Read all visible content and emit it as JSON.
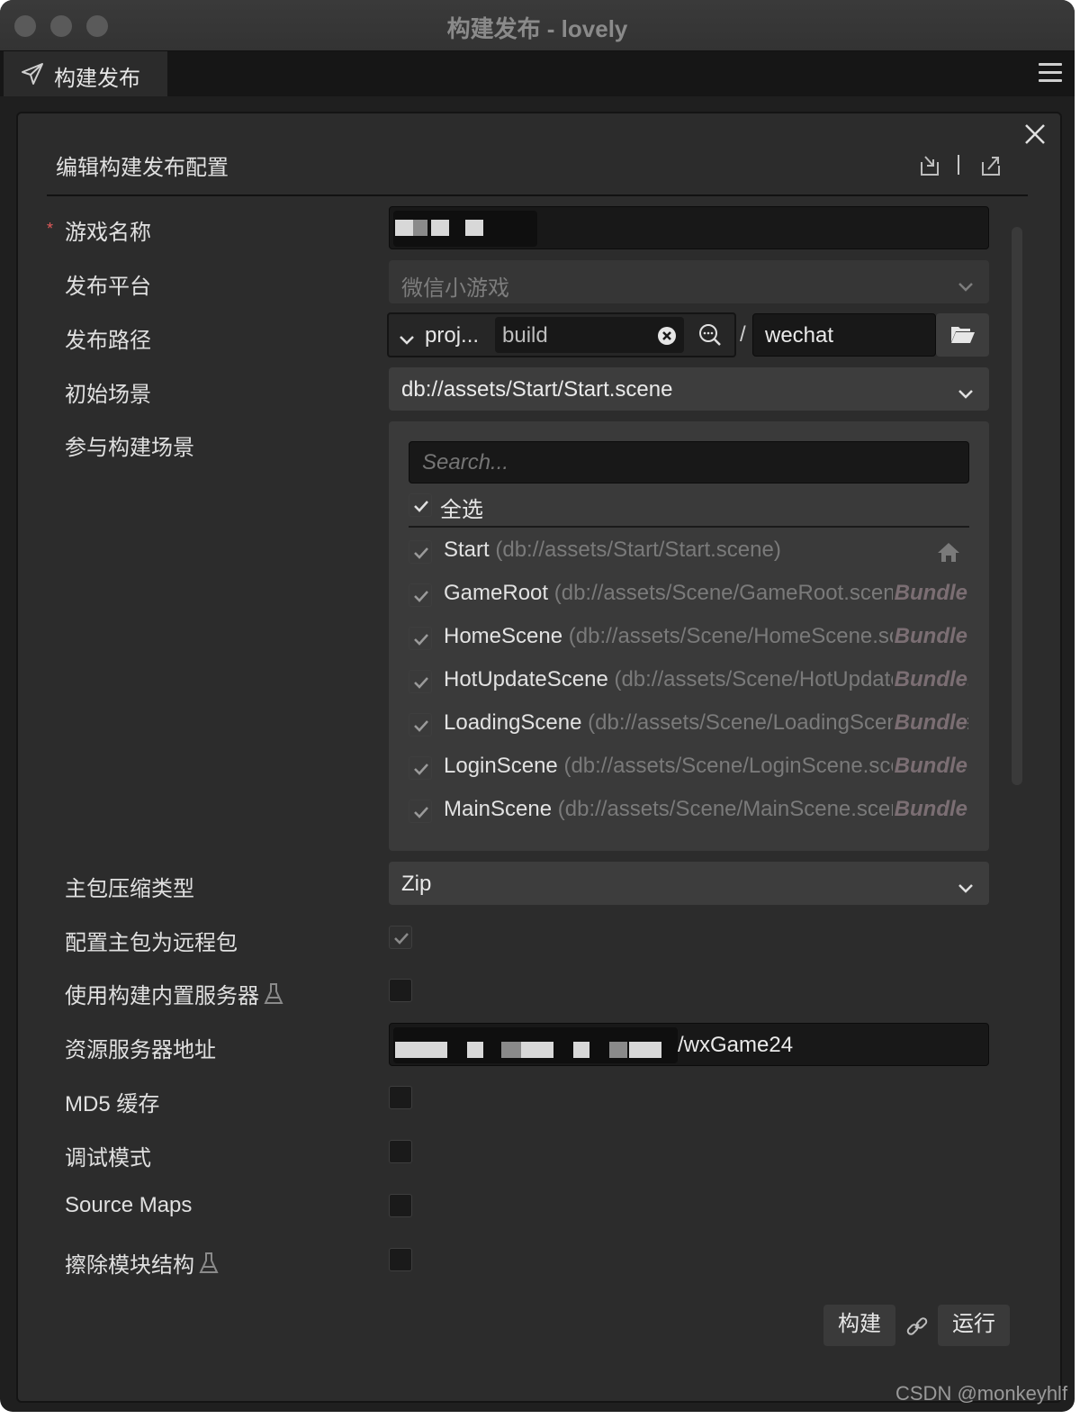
{
  "window": {
    "title": "构建发布 - lovely"
  },
  "tab": {
    "label": "构建发布",
    "icon": "paper-plane-icon"
  },
  "panel": {
    "title": "编辑构建发布配置",
    "import_icon": "import-icon",
    "export_icon": "export-icon",
    "close_icon": "close-icon"
  },
  "form": {
    "game_name": {
      "label": "游戏名称",
      "required_mark": "*",
      "value": ""
    },
    "platform": {
      "label": "发布平台",
      "value": "微信小游戏"
    },
    "build_path": {
      "label": "发布路径",
      "prefix": "proj...",
      "folder": "build",
      "separator": "/",
      "name": "wechat"
    },
    "start_scene": {
      "label": "初始场景",
      "value": "db://assets/Start/Start.scene"
    },
    "scenes": {
      "label": "参与构建场景",
      "search_placeholder": "Search...",
      "select_all": "全选",
      "items": [
        {
          "name": "Start",
          "path": "(db://assets/Start/Start.scene)",
          "checked": true,
          "badge": "",
          "home": true
        },
        {
          "name": "GameRoot",
          "path": "(db://assets/Scene/GameRoot.scene)",
          "checked": true,
          "badge": "Bundle"
        },
        {
          "name": "HomeScene",
          "path": "(db://assets/Scene/HomeScene.scene)",
          "checked": true,
          "badge": "Bundle"
        },
        {
          "name": "HotUpdateScene",
          "path": "(db://assets/Scene/HotUpdateScene.scene)",
          "checked": true,
          "badge": "Bundle"
        },
        {
          "name": "LoadingScene",
          "path": "(db://assets/Scene/LoadingScene.scene)",
          "checked": true,
          "badge": "Bundle"
        },
        {
          "name": "LoginScene",
          "path": "(db://assets/Scene/LoginScene.scene)",
          "checked": true,
          "badge": "Bundle"
        },
        {
          "name": "MainScene",
          "path": "(db://assets/Scene/MainScene.scene)",
          "checked": true,
          "badge": "Bundle"
        }
      ]
    },
    "compression": {
      "label": "主包压缩类型",
      "value": "Zip"
    },
    "remote_main": {
      "label": "配置主包为远程包",
      "checked": true
    },
    "builtin_server": {
      "label": "使用构建内置服务器",
      "checked": false,
      "experimental_icon": "flask-icon"
    },
    "server_url": {
      "label": "资源服务器地址",
      "value": "/wxGame24"
    },
    "md5": {
      "label": "MD5 缓存",
      "checked": false
    },
    "debug": {
      "label": "调试模式",
      "checked": false
    },
    "source_maps": {
      "label": "Source Maps",
      "checked": false
    },
    "mangle": {
      "label": "擦除模块结构",
      "checked": false,
      "experimental_icon": "flask-icon"
    }
  },
  "actions": {
    "build": "构建",
    "link_icon": "link-icon",
    "run": "运行"
  },
  "watermark": "CSDN @monkeyhlf"
}
